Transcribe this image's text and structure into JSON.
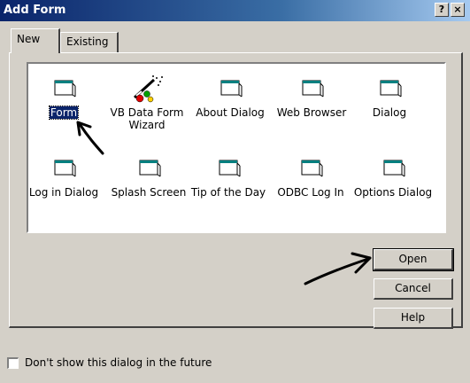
{
  "window": {
    "title": "Add Form",
    "help_glyph": "?",
    "close_glyph": "×"
  },
  "tabs": [
    {
      "label": "New",
      "active": true
    },
    {
      "label": "Existing",
      "active": false
    }
  ],
  "items": [
    {
      "label": "Form",
      "selected": true,
      "icon": "form-icon"
    },
    {
      "label": "VB Data Form\nWizard",
      "selected": false,
      "icon": "wizard-wand-icon"
    },
    {
      "label": "About Dialog",
      "selected": false,
      "icon": "form-icon"
    },
    {
      "label": "Web Browser",
      "selected": false,
      "icon": "form-icon"
    },
    {
      "label": "Dialog",
      "selected": false,
      "icon": "form-icon"
    },
    {
      "label": "Log in Dialog",
      "selected": false,
      "icon": "form-icon"
    },
    {
      "label": "Splash Screen",
      "selected": false,
      "icon": "form-icon"
    },
    {
      "label": "Tip of the Day",
      "selected": false,
      "icon": "form-icon"
    },
    {
      "label": "ODBC Log In",
      "selected": false,
      "icon": "form-icon"
    },
    {
      "label": "Options Dialog",
      "selected": false,
      "icon": "form-icon"
    }
  ],
  "buttons": {
    "open": "Open",
    "cancel": "Cancel",
    "help": "Help"
  },
  "checkbox": {
    "label": "Don't show this dialog in the future",
    "checked": false
  },
  "annotations": [
    "hand-drawn-arrow-to-form",
    "hand-drawn-arrow-to-open"
  ]
}
